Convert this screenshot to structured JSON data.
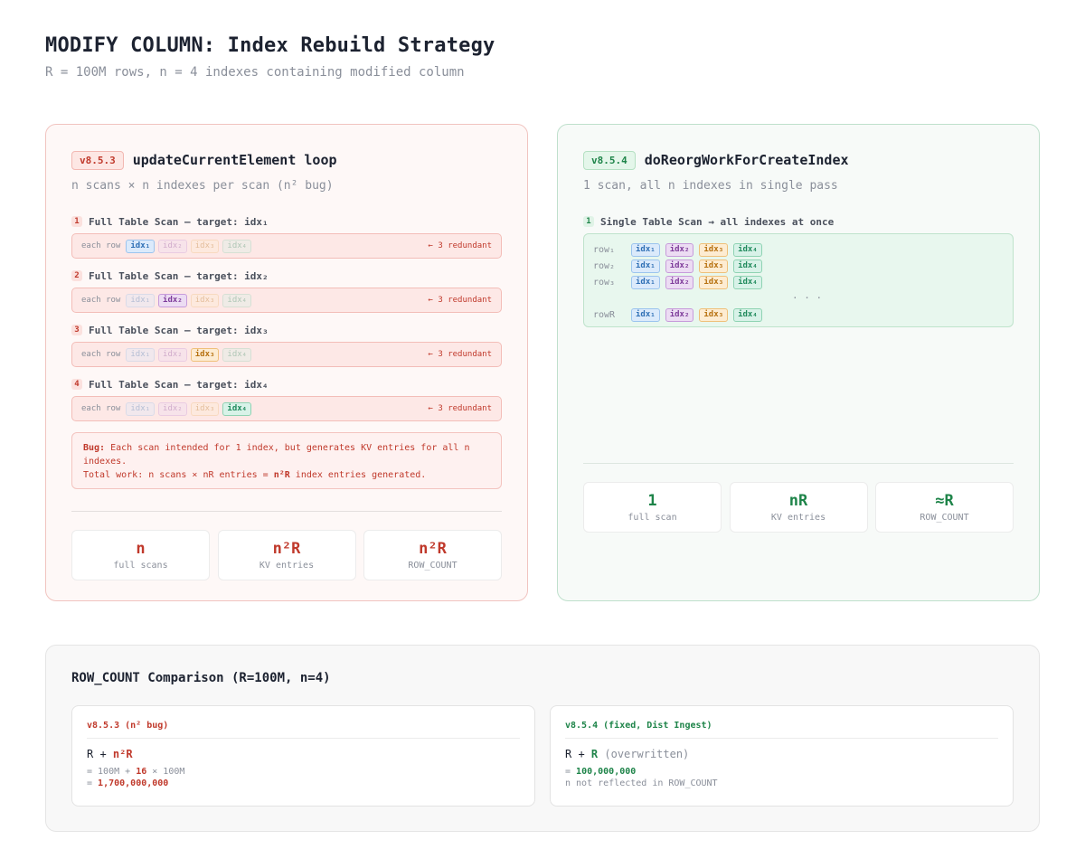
{
  "header": {
    "title": "MODIFY COLUMN: Index Rebuild Strategy",
    "subtitle": "R = 100M rows, n = 4 indexes containing modified column"
  },
  "left": {
    "version": "v8.5.3",
    "title": "updateCurrentElement loop",
    "desc": "n scans × n indexes per scan (n² bug)",
    "row_label": "each row",
    "redundant_label": "← 3 redundant",
    "chips": [
      "idx₁",
      "idx₂",
      "idx₃",
      "idx₄"
    ],
    "scans": [
      {
        "num": "1",
        "label": "Full Table Scan — target: idx₁"
      },
      {
        "num": "2",
        "label": "Full Table Scan — target: idx₂"
      },
      {
        "num": "3",
        "label": "Full Table Scan — target: idx₃"
      },
      {
        "num": "4",
        "label": "Full Table Scan — target: idx₄"
      }
    ],
    "bug": {
      "prefix": "Bug:",
      "line1": "Each scan intended for 1 index, but generates KV entries for all n indexes.",
      "line2_pre": "Total work: n scans × nR entries = ",
      "line2_bold": "n²R",
      "line2_post": " index entries generated."
    },
    "stats": [
      {
        "value": "n",
        "label": "full scans"
      },
      {
        "value": "n²R",
        "label": "KV entries"
      },
      {
        "value": "n²R",
        "label": "ROW_COUNT"
      }
    ]
  },
  "right": {
    "version": "v8.5.4",
    "title": "doReorgWorkForCreateIndex",
    "desc": "1 scan, all n indexes in single pass",
    "scan": {
      "num": "1",
      "label": "Single Table Scan → all indexes at once"
    },
    "rows": [
      "row₁",
      "row₂",
      "row₃"
    ],
    "dots": "· · ·",
    "last_row": "rowR",
    "chips": [
      "idx₁",
      "idx₂",
      "idx₃",
      "idx₄"
    ],
    "stats": [
      {
        "value": "1",
        "label": "full scan"
      },
      {
        "value": "nR",
        "label": "KV entries"
      },
      {
        "value": "≈R",
        "label": "ROW_COUNT"
      }
    ]
  },
  "comparison": {
    "title": "ROW_COUNT Comparison (R=100M, n=4)",
    "left": {
      "head": "v8.5.3 (n² bug)",
      "formula_a": "R + ",
      "formula_b": "n²R",
      "calc1_pre": "= 100M + ",
      "calc1_bold": "16",
      "calc1_post": " × 100M",
      "calc2_pre": "= ",
      "calc2_bold": "1,700,000,000"
    },
    "right": {
      "head": "v8.5.4 (fixed, Dist Ingest)",
      "formula_a": "R + ",
      "formula_b": "R",
      "formula_c": " (overwritten)",
      "calc1_pre": "= ",
      "calc1_bold": "100,000,000",
      "calc2": "n not reflected in ROW_COUNT"
    }
  },
  "colors": {
    "red": "#c0392b",
    "green": "#1e8449",
    "idx1": "#2e6fb5",
    "idx2": "#7e3b9a",
    "idx3": "#b6700e",
    "idx4": "#1f8a5c"
  }
}
